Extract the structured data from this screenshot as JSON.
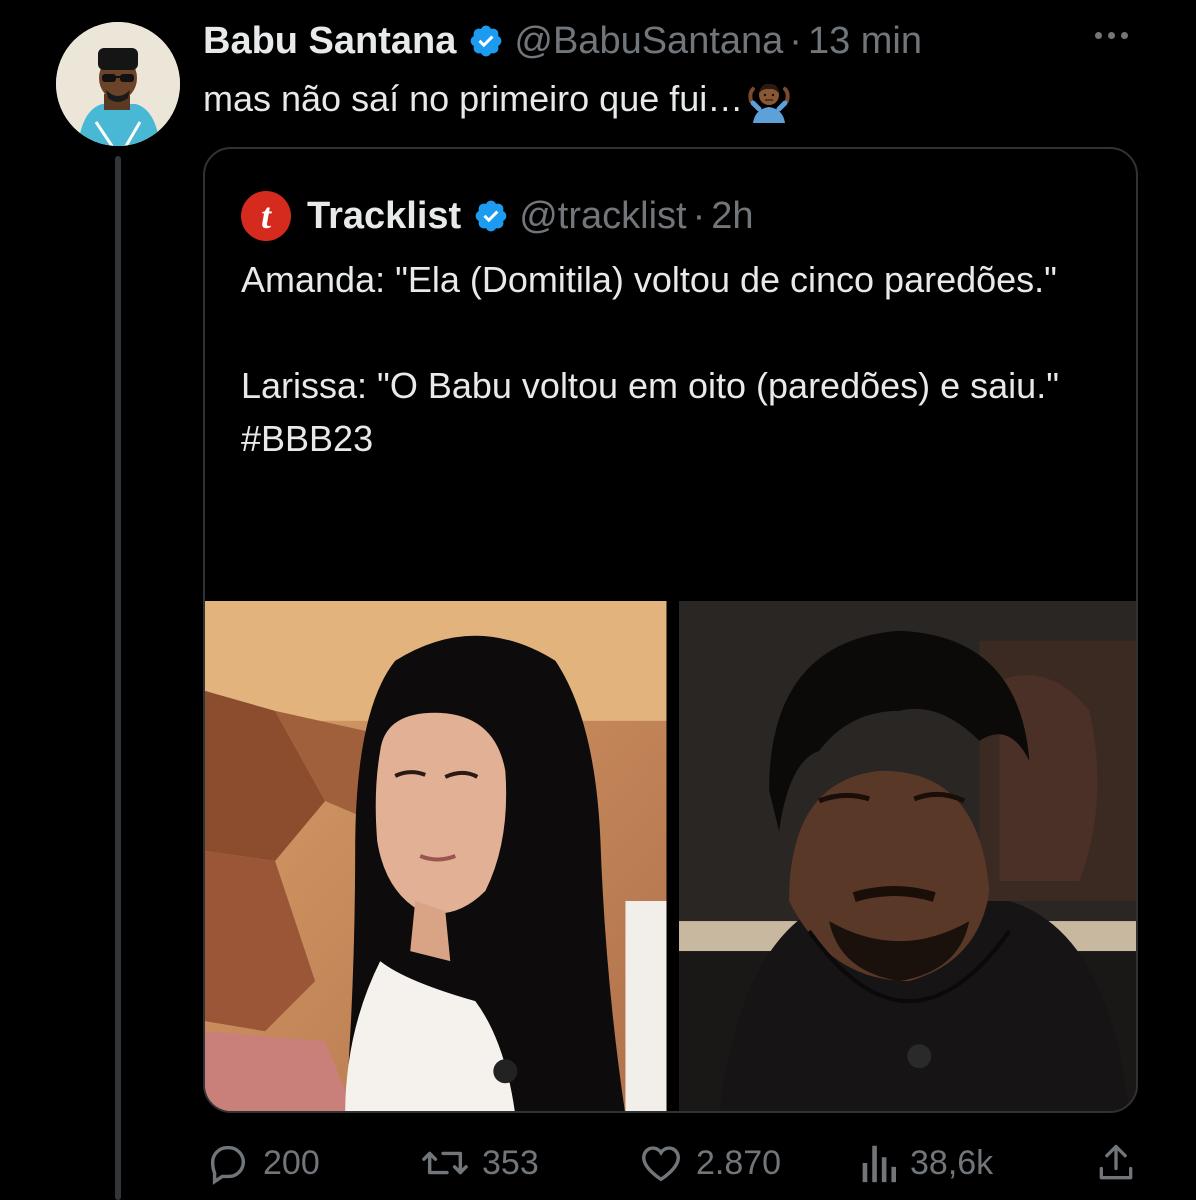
{
  "tweet": {
    "author_name": "Babu Santana",
    "author_handle": "@BabuSantana",
    "separator": "·",
    "time": "13 min",
    "text": "mas não saí no primeiro que fui…",
    "emoji_icon": "person-shrugging-icon"
  },
  "quoted_tweet": {
    "avatar_letter": "t",
    "author_name": "Tracklist",
    "author_handle": "@tracklist",
    "separator": "·",
    "time": "2h",
    "lines": [
      "Amanda: \"Ela (Domitila) voltou de cinco paredões.\"",
      "Larissa: \"O Babu voltou em oito (paredões) e saiu.\"",
      "#BBB23"
    ],
    "media": [
      "photo-woman-long-dark-hair",
      "photo-man-black-shirt"
    ]
  },
  "actions": {
    "replies": "200",
    "retweets": "353",
    "likes": "2.870",
    "views": "38,6k"
  },
  "colors": {
    "background": "#000000",
    "text": "#e7e9ea",
    "muted": "#71767b",
    "verified": "#1d9bf0",
    "tracklist_red": "#d52b1e",
    "border": "#2f3336"
  }
}
